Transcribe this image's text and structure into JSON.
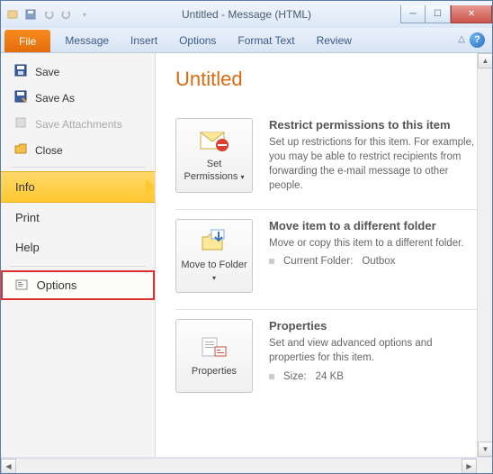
{
  "window": {
    "title": "Untitled - Message (HTML)"
  },
  "ribbon": {
    "file": "File",
    "tabs": [
      "Message",
      "Insert",
      "Options",
      "Format Text",
      "Review"
    ]
  },
  "sidebar": {
    "save": "Save",
    "save_as": "Save As",
    "save_attachments": "Save Attachments",
    "close": "Close",
    "nav": {
      "info": "Info",
      "print": "Print",
      "help": "Help",
      "options": "Options"
    }
  },
  "page": {
    "title": "Untitled",
    "permissions": {
      "button": "Set Permissions",
      "heading": "Restrict permissions to this item",
      "desc": "Set up restrictions for this item. For example, you may be able to restrict recipients from forwarding the e-mail message to other people."
    },
    "move": {
      "button": "Move to Folder",
      "heading": "Move item to a different folder",
      "desc": "Move or copy this item to a different folder.",
      "current_label": "Current Folder:",
      "current_value": "Outbox"
    },
    "properties": {
      "button": "Properties",
      "heading": "Properties",
      "desc": "Set and view advanced options and properties for this item.",
      "size_label": "Size:",
      "size_value": "24 KB"
    }
  }
}
